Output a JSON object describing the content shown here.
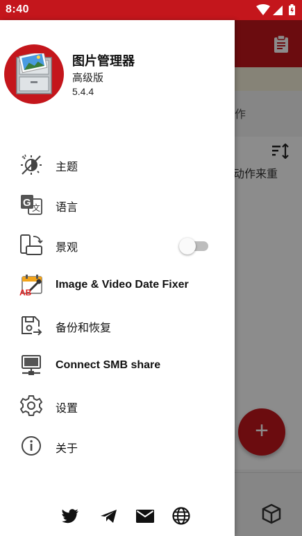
{
  "status_bar": {
    "time": "8:40",
    "icons": [
      "wifi-icon",
      "signal-icon",
      "battery-icon"
    ]
  },
  "background_app": {
    "tab_text": "工作",
    "card_text": "动作来重",
    "fab_label": "+",
    "icons": [
      "clipboard-icon",
      "sort-icon",
      "cube-icon"
    ]
  },
  "drawer": {
    "header": {
      "app_name": "图片管理器",
      "edition": "高级版",
      "version": "5.4.4"
    },
    "items": [
      {
        "label": "主题",
        "icon": "theme-icon"
      },
      {
        "label": "语言",
        "icon": "translate-icon"
      },
      {
        "label": "景观",
        "icon": "screen-rotation-icon",
        "toggle": false
      },
      {
        "label": "Image & Video Date Fixer",
        "icon": "calendar-fix-icon"
      },
      {
        "label": "备份和恢复",
        "icon": "backup-restore-icon"
      },
      {
        "label": "Connect SMB share",
        "icon": "network-share-icon"
      },
      {
        "label": "设置",
        "icon": "settings-icon"
      },
      {
        "label": "关于",
        "icon": "info-icon"
      }
    ],
    "social": [
      "twitter-icon",
      "telegram-icon",
      "email-icon",
      "web-icon"
    ]
  },
  "colors": {
    "brand": "#c4161c",
    "scrim": "#000000",
    "toggle_off": "#bdbdbd"
  }
}
